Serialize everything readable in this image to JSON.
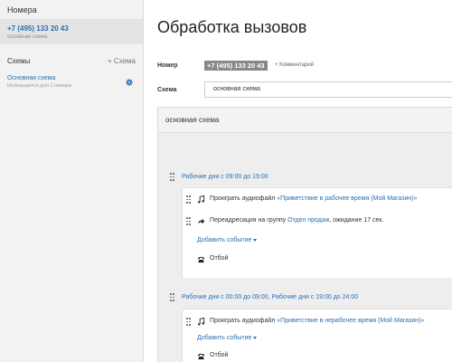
{
  "sidebar": {
    "numbers_header": "Номера",
    "number": {
      "value": "+7 (495) 133 20 43",
      "scheme": "основная схема"
    },
    "schemes_header": "Схемы",
    "add_scheme": "+ Схема",
    "scheme": {
      "name": "Основная схема",
      "usage": "Используется для 1 номера"
    }
  },
  "main": {
    "title": "Обработка вызовов",
    "number_label": "Номер",
    "number_badge": "+7 (495) 133 20 43",
    "comment_link": "+ Комментарий",
    "scheme_label": "Схема",
    "scheme_select": "основная схема",
    "panel_title": "основная схема",
    "rules": [
      {
        "title": "Рабочие дни с 09:00 до 19:00",
        "events": [
          {
            "icon": "music-note-icon",
            "prefix": "Проиграть аудиофайл ",
            "link": "«Приветствие в рабочее время (Мой Магазин)»",
            "suffix": ""
          },
          {
            "icon": "redirect-arrow-icon",
            "prefix": "Переадресация на группу ",
            "link": "Отдел продаж",
            "suffix": ", ожидание 17 сек."
          }
        ],
        "add_event": "Добавить событие",
        "final": "Отбой"
      },
      {
        "title": "Рабочие дни с 00:00 до 09:00, Рабочие дни с 19:00 до 24:00",
        "events": [
          {
            "icon": "music-note-icon",
            "prefix": "Проиграть аудиофайл ",
            "link": "«Приветствие в нерабочее время (Мой Магазин)»",
            "suffix": ""
          }
        ],
        "add_event": "Добавить событие",
        "final": "Отбой"
      }
    ]
  },
  "colors": {
    "link": "#2a6fb0",
    "sidebar_bg": "#f2f2f2",
    "badge_bg": "#888888"
  }
}
